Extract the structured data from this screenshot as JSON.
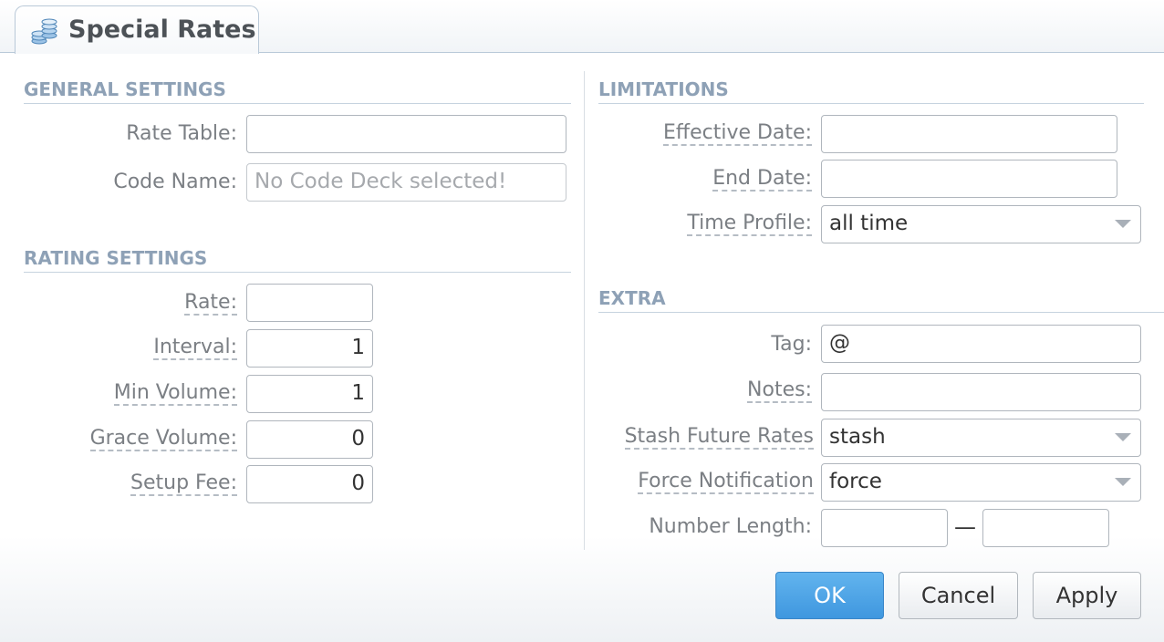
{
  "tab": {
    "title": "Special Rates",
    "icon": "coins-stack-icon"
  },
  "general": {
    "title": "GENERAL SETTINGS",
    "rate_table_label": "Rate Table:",
    "rate_table_value": "",
    "code_name_label": "Code Name:",
    "code_name_placeholder": "No Code Deck selected!"
  },
  "rating": {
    "title": "RATING SETTINGS",
    "rate_label": "Rate:",
    "rate_value": "",
    "interval_label": "Interval:",
    "interval_value": "1",
    "min_volume_label": "Min Volume:",
    "min_volume_value": "1",
    "grace_volume_label": "Grace Volume:",
    "grace_volume_value": "0",
    "setup_fee_label": "Setup Fee:",
    "setup_fee_value": "0"
  },
  "limitations": {
    "title": "LIMITATIONS",
    "effective_date_label": "Effective Date:",
    "effective_date_value": "",
    "end_date_label": "End Date:",
    "end_date_value": "",
    "time_profile_label": "Time Profile:",
    "time_profile_value": "all time"
  },
  "extra": {
    "title": "EXTRA",
    "tag_label": "Tag:",
    "tag_value": "@",
    "notes_label": "Notes:",
    "notes_value": "",
    "stash_label": "Stash Future Rates",
    "stash_value": "stash",
    "force_label": "Force Notification",
    "force_value": "force",
    "number_length_label": "Number Length:",
    "number_length_from": "",
    "number_length_separator": "—",
    "number_length_to": ""
  },
  "buttons": {
    "ok": "OK",
    "cancel": "Cancel",
    "apply": "Apply"
  },
  "colors": {
    "section_title": "#8ea1b6",
    "primary_button": "#4aa3e6"
  }
}
